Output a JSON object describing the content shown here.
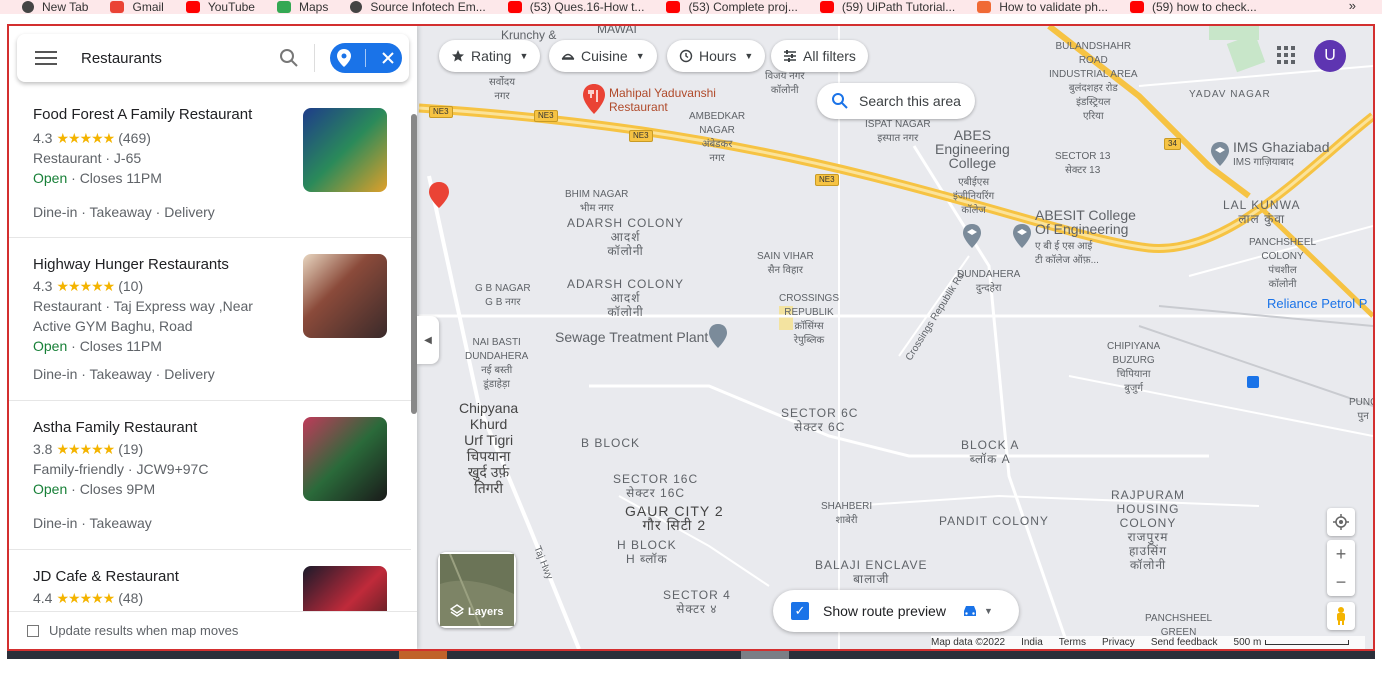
{
  "bookmarks": {
    "items": [
      {
        "label": "New Tab",
        "color": "#444"
      },
      {
        "label": "Gmail",
        "color": "#ea4335"
      },
      {
        "label": "YouTube",
        "color": "#ff0000"
      },
      {
        "label": "Maps",
        "color": "#34a853"
      },
      {
        "label": "Source Infotech Em...",
        "color": "#444"
      },
      {
        "label": "(53) Ques.16-How t...",
        "color": "#ff0000"
      },
      {
        "label": "(53) Complete proj...",
        "color": "#ff0000"
      },
      {
        "label": "(59) UiPath Tutorial...",
        "color": "#ff0000"
      },
      {
        "label": "How to validate ph...",
        "color": "#f06a35"
      },
      {
        "label": "(59) how to check...",
        "color": "#ff0000"
      }
    ],
    "more": "»"
  },
  "search": {
    "query": "Restaurants"
  },
  "results": [
    {
      "name": "Food Forest A Family Restaurant",
      "rating": "4.3",
      "stars": "★★★★★",
      "reviews": "(469)",
      "info": "Restaurant · J-65",
      "info2": "",
      "status_open": "Open",
      "status_close": " · Closes 11PM",
      "services": "Dine-in · Takeaway · Delivery",
      "thumb_color": "#1d4e5e"
    },
    {
      "name": "Highway Hunger Restaurants",
      "rating": "4.3",
      "stars": "★★★★★",
      "reviews": "(10)",
      "info": "Restaurant · Taj Express way ,Near",
      "info2": "Active GYM Baghu, Road",
      "status_open": "Open",
      "status_close": " · Closes 11PM",
      "services": "Dine-in · Takeaway · Delivery",
      "thumb_color": "#6d4a3b"
    },
    {
      "name": "Astha Family Restaurant",
      "rating": "3.8",
      "stars": "★★★★★",
      "reviews": "(19)",
      "info": "Family-friendly · JCW9+97C",
      "info2": "",
      "status_open": "Open",
      "status_close": " · Closes 9PM",
      "services": "Dine-in · Takeaway",
      "thumb_color": "#8a3a4a"
    },
    {
      "name": "JD Cafe & Restaurant",
      "rating": "4.4",
      "stars": "★★★★★",
      "reviews": "(48)",
      "info": "",
      "info2": "",
      "status_open": "",
      "status_close": "",
      "services": "",
      "thumb_color": "#3a2530"
    }
  ],
  "footer": {
    "checkbox_label": "Update results when map moves"
  },
  "filters": {
    "rating": "Rating",
    "cuisine": "Cuisine",
    "hours": "Hours",
    "all": "All filters"
  },
  "map": {
    "search_area": "Search this area",
    "avatar": "U",
    "layers": "Layers",
    "route": "Show route preview",
    "attribution": {
      "data": "Map data ©2022",
      "country": "India",
      "terms": "Terms",
      "privacy": "Privacy",
      "feedback": "Send feedback",
      "scale": "500 m"
    },
    "labels": {
      "krunchy": "Krunchy &",
      "mawai": "MAWAI",
      "sarvodaya": "सर्वोदय\nनगर",
      "vijay": "विजय नगर\nकॉलोनी",
      "mahipal": "Mahipal Yaduvanshi\nRestaurant",
      "ambedkar": "AMBEDKAR\nNAGAR\nअंबेडकर\nनगर",
      "ispat": "ISPAT NAGAR\nइस्पात नगर",
      "abes": "ABES\nEngineering\nCollege",
      "abes_hi": "एबीईएस\nइंजीनियरिंग\nकॉलेज",
      "sector13": "SECTOR 13\nसेक्टर 13",
      "bulandshahr": "BULANDSHAHR\nROAD\nINDUSTRIAL AREA\nबुलंदशहर रोड\nइंडस्ट्रियल\nएरिया",
      "yadav": "YADAV NAGAR",
      "ims": "IMS Ghaziabad",
      "ims_hi": "IMS गाज़ियाबाद",
      "lalkunwa": "LAL KUNWA\nलाल कुंवा",
      "panchsheel": "PANCHSHEEL\nCOLONY\nपंचशील\nकॉलोनी",
      "reliance": "Reliance Petrol P",
      "bhim": "BHIM NAGAR\nभीम नगर",
      "adarsh1": "ADARSH COLONY\nआदर्श\nकॉलोनी",
      "adarsh2": "ADARSH COLONY\nआदर्श\nकॉलोनी",
      "gb": "G B NAGAR\nG B नगर",
      "sain": "SAIN VIHAR\nसैन विहार",
      "crossings": "CROSSINGS\nREPUBLIK\nक्रॉसिंग्स\nरेपुब्लिक",
      "crossings_rd": "Crossings Republik Rd",
      "abesit": "ABESIT College\nOf Engineering",
      "abesit_hi": "ए बी ई एस आई\nटी कॉलेज ऑफ़...",
      "dundahera": "DUNDAHERA\nदुन्दहेरा",
      "nai": "NAI BASTI\nDUNDAHERA\nनई बस्ती\nडूंडाहेड़ा",
      "sewage": "Sewage Treatment Plant",
      "chipyana_b": "CHIPIYANA\nBUZURG\nचिपियाना\nबुजुर्ग",
      "chipyana": "Chipyana\nKhurd\nUrf Tigri\nचिपयाना\nखुर्द उर्फ़\nतिगरी",
      "sector6c": "SECTOR 6C\nसेक्टर 6C",
      "bblock": "B BLOCK",
      "blocka": "BLOCK A\nब्लॉक A",
      "sector16c": "SECTOR 16C\nसेक्टर 16C",
      "gaur": "GAUR CITY 2\nगौर सिटी 2",
      "hblock": "H BLOCK\nH ब्लॉक",
      "shahberi": "SHAHBERI\nशाबेरी",
      "pandit": "PANDIT COLONY",
      "rajpuram": "RAJPURAM\nHOUSING\nCOLONY\nराजपुरम\nहाउसिंग\nकॉलोनी",
      "balaji": "BALAJI ENCLAVE\nबालाजी",
      "sector4": "SECTOR 4\nसेक्टर ४",
      "panchsheel_g": "PANCHSHEEL\nGREEN",
      "taj": "Taj Hwy",
      "punc": "PUNC\nपुन",
      "ne3": "NE3",
      "r34": "34"
    }
  },
  "colors": {
    "accent": "#1a73e8",
    "open": "#188038",
    "star": "#f4b400",
    "highway": "#f6c343",
    "frame": "#d32f2f"
  }
}
